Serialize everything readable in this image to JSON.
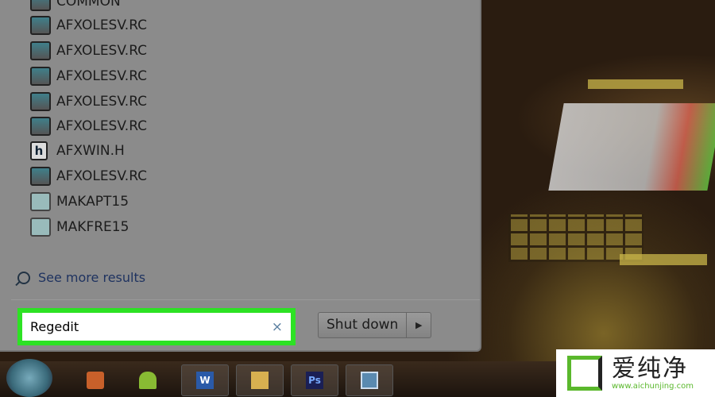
{
  "results": [
    {
      "label": "COMMON",
      "icon": "common-folder-icon"
    },
    {
      "label": "AFXOLESV.RC",
      "icon": "resource-file-icon"
    },
    {
      "label": "AFXOLESV.RC",
      "icon": "resource-file-icon"
    },
    {
      "label": "AFXOLESV.RC",
      "icon": "resource-file-icon"
    },
    {
      "label": "AFXOLESV.RC",
      "icon": "resource-file-icon"
    },
    {
      "label": "AFXOLESV.RC",
      "icon": "resource-file-icon"
    },
    {
      "label": "AFXWIN.H",
      "icon": "header-file-icon"
    },
    {
      "label": "AFXOLESV.RC",
      "icon": "resource-file-icon"
    },
    {
      "label": "MAKAPT15",
      "icon": "makefile-icon"
    },
    {
      "label": "MAKFRE15",
      "icon": "makefile-icon"
    }
  ],
  "see_more": "See more results",
  "search": {
    "value": "Regedit",
    "clear": "×"
  },
  "shutdown": {
    "label": "Shut down",
    "arrow": "▶"
  },
  "taskbar": {
    "word": "W",
    "ps": "Ps"
  },
  "watermark": {
    "name": "爱纯净",
    "url": "www.aichunjing.com"
  },
  "colors": {
    "highlight": "#2de224"
  }
}
